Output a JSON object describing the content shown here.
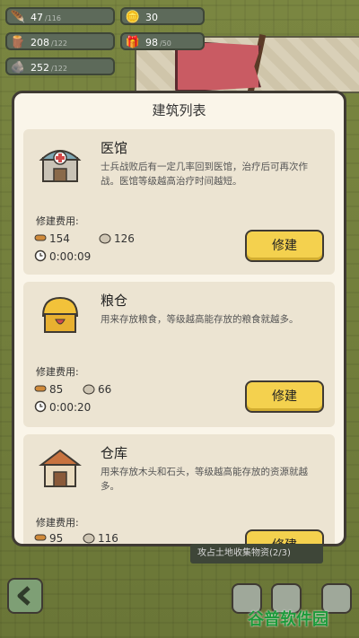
{
  "hud": {
    "soldiers": {
      "value": "47",
      "max": "/116",
      "icon": "soldier-icon"
    },
    "wood": {
      "value": "208",
      "max": "/122",
      "icon": "wood-icon"
    },
    "stone": {
      "value": "252",
      "max": "/122",
      "icon": "stone-icon"
    },
    "coin": {
      "value": "30",
      "icon": "coin-icon"
    },
    "food": {
      "value": "98",
      "max": "/50",
      "icon": "gift-icon"
    }
  },
  "modal": {
    "title": "建筑列表",
    "buildings": [
      {
        "name": "医馆",
        "desc": "士兵战败后有一定几率回到医馆，治疗后可再次作战。医馆等级越高治疗时间越短。",
        "cost_label": "修建费用:",
        "wood": "154",
        "stone": "126",
        "time": "0:00:09",
        "button": "修建"
      },
      {
        "name": "粮仓",
        "desc": "用来存放粮食，等级越高能存放的粮食就越多。",
        "cost_label": "修建费用:",
        "wood": "85",
        "stone": "66",
        "time": "0:00:20",
        "button": "修建"
      },
      {
        "name": "仓库",
        "desc": "用来存放木头和石头，等级越高能存放的资源就越多。",
        "cost_label": "修建费用:",
        "wood": "95",
        "stone": "116",
        "time": "",
        "button": "修建"
      }
    ]
  },
  "quest": "攻占土地收集物资(2/3)",
  "watermark": {
    "part1": "谷普",
    "part2": "软件园"
  },
  "colors": {
    "button": "#f4d14e",
    "panel": "#faf5e9",
    "card": "#ece4d2"
  }
}
